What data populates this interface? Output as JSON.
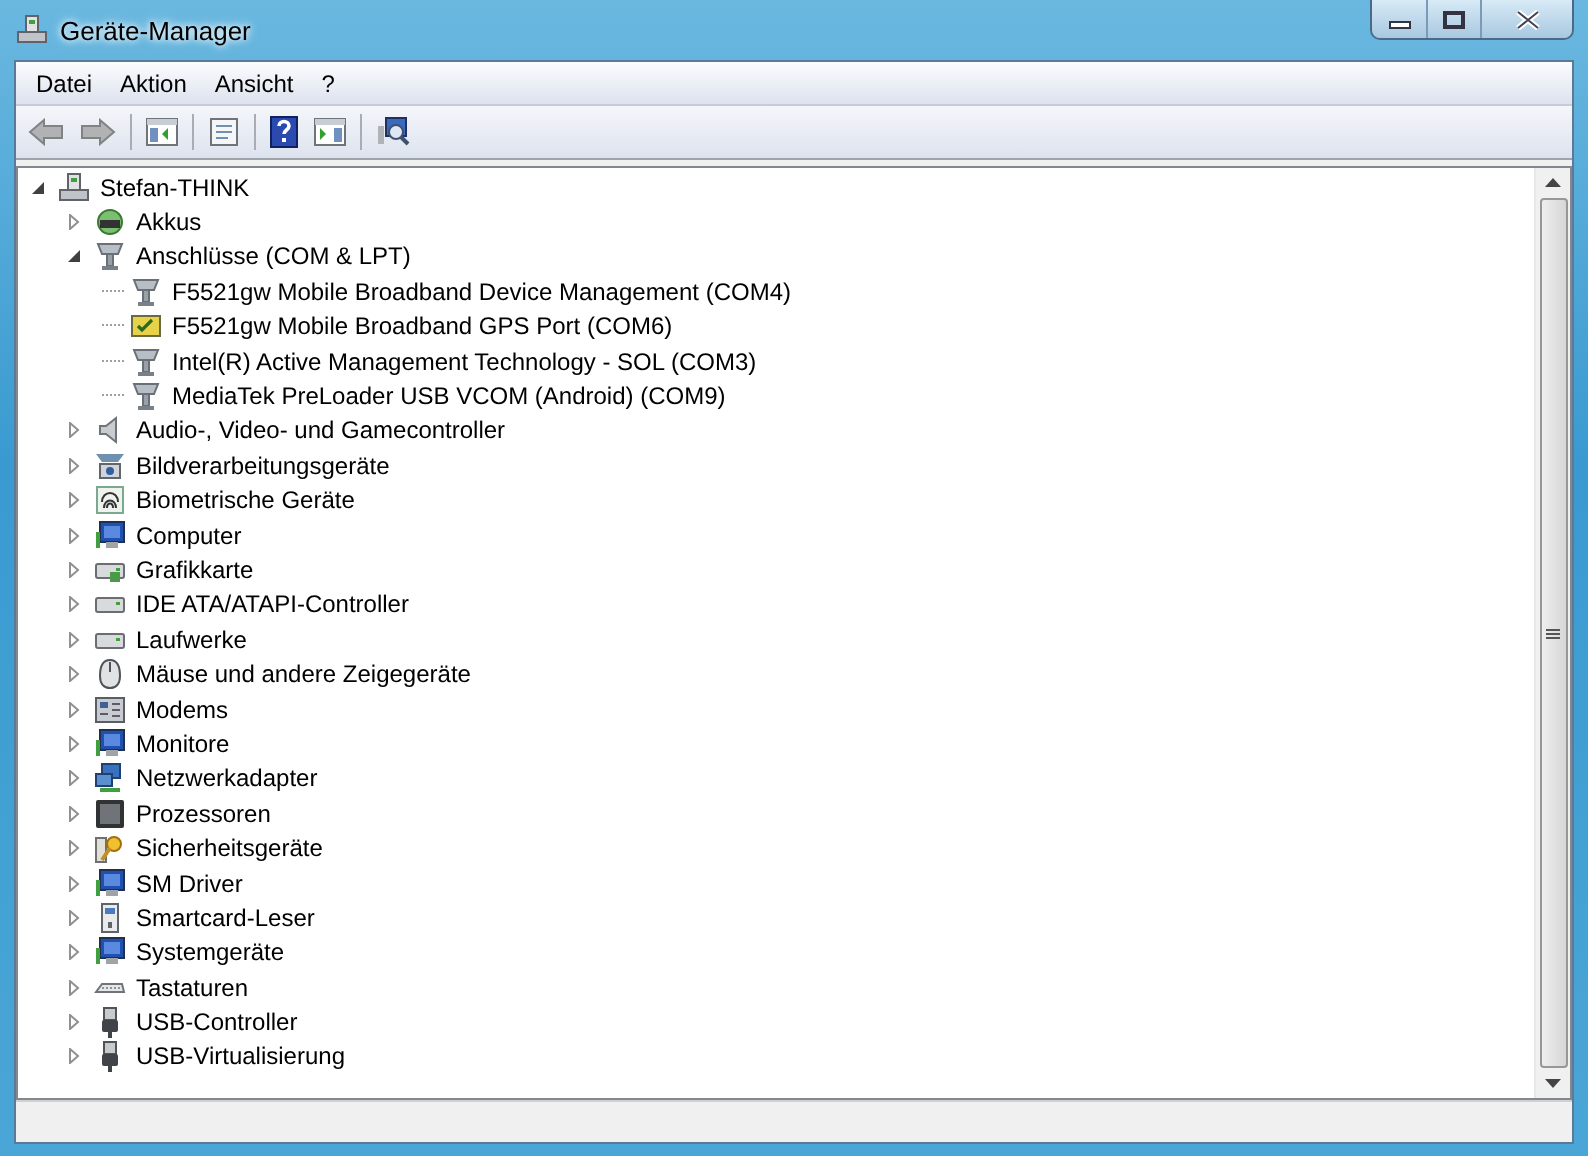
{
  "window": {
    "title": "Geräte-Manager"
  },
  "menu": [
    "Datei",
    "Aktion",
    "Ansicht",
    "?"
  ],
  "tree": {
    "label": "Stefan-THINK",
    "expanded": true,
    "children": [
      {
        "label": "Akkus",
        "expanded": false
      },
      {
        "label": "Anschlüsse (COM & LPT)",
        "expanded": true,
        "children": [
          {
            "label": "F5521gw Mobile Broadband Device Management (COM4)"
          },
          {
            "label": "F5521gw Mobile Broadband GPS Port (COM6)"
          },
          {
            "label": "Intel(R) Active Management Technology - SOL (COM3)"
          },
          {
            "label": "MediaTek PreLoader USB VCOM (Android) (COM9)"
          }
        ]
      },
      {
        "label": "Audio-, Video- und Gamecontroller",
        "expanded": false
      },
      {
        "label": "Bildverarbeitungsgeräte",
        "expanded": false
      },
      {
        "label": "Biometrische Geräte",
        "expanded": false
      },
      {
        "label": "Computer",
        "expanded": false
      },
      {
        "label": "Grafikkarte",
        "expanded": false
      },
      {
        "label": "IDE ATA/ATAPI-Controller",
        "expanded": false
      },
      {
        "label": "Laufwerke",
        "expanded": false
      },
      {
        "label": "Mäuse und andere Zeigegeräte",
        "expanded": false
      },
      {
        "label": "Modems",
        "expanded": false
      },
      {
        "label": "Monitore",
        "expanded": false
      },
      {
        "label": "Netzwerkadapter",
        "expanded": false
      },
      {
        "label": "Prozessoren",
        "expanded": false
      },
      {
        "label": "Sicherheitsgeräte",
        "expanded": false
      },
      {
        "label": "SM Driver",
        "expanded": false
      },
      {
        "label": "Smartcard-Leser",
        "expanded": false
      },
      {
        "label": "Systemgeräte",
        "expanded": false
      },
      {
        "label": "Tastaturen",
        "expanded": false
      },
      {
        "label": "USB-Controller",
        "expanded": false
      },
      {
        "label": "USB-Virtualisierung",
        "expanded": false
      }
    ]
  }
}
